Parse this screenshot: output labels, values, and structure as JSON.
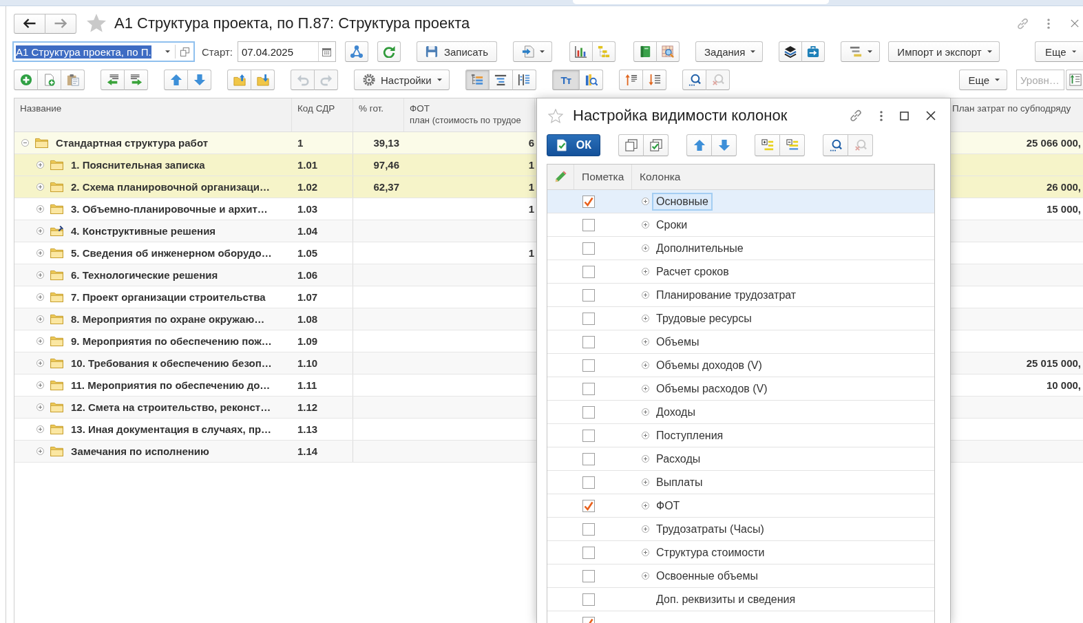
{
  "form": {
    "title": "А1 Структура проекта, по П.87: Структура проекта",
    "nav_buttons": [
      {
        "disabled": false
      },
      {
        "disabled": true
      }
    ]
  },
  "toolbar_rows": [
    [
      {
        "kind": "select",
        "value": "А1 Структура проекта, по П.",
        "focused": true
      },
      {
        "kind": "label",
        "text": "Старт:"
      },
      {
        "kind": "date",
        "value": "07.04.2025"
      },
      {
        "kind": "group",
        "buttons": [
          {
            "menu": false,
            "pressed": false,
            "disabled": false
          }
        ]
      },
      {
        "kind": "group",
        "buttons": [
          {
            "menu": false,
            "pressed": false,
            "disabled": false
          }
        ]
      },
      {
        "kind": "group",
        "buttons": [
          {
            "label": "Записать",
            "menu": false,
            "pressed": false,
            "disabled": false
          }
        ]
      },
      {
        "kind": "group",
        "buttons": [
          {
            "menu": true,
            "pressed": false,
            "disabled": false
          }
        ]
      },
      {
        "kind": "group",
        "buttons": [
          {
            "menu": false,
            "pressed": false,
            "disabled": false
          },
          {
            "menu": false,
            "pressed": false,
            "disabled": false
          }
        ]
      },
      {
        "kind": "group",
        "buttons": [
          {
            "menu": false,
            "pressed": false,
            "disabled": false
          },
          {
            "menu": false,
            "pressed": false,
            "disabled": false
          }
        ]
      },
      {
        "kind": "group",
        "buttons": [
          {
            "label": "Задания",
            "menu": true,
            "pressed": false,
            "disabled": false
          }
        ]
      },
      {
        "kind": "group",
        "buttons": [
          {
            "menu": false,
            "pressed": false,
            "disabled": false
          },
          {
            "menu": false,
            "pressed": false,
            "disabled": false
          }
        ]
      },
      {
        "kind": "group",
        "buttons": [
          {
            "menu": true,
            "pressed": false,
            "disabled": false
          }
        ]
      },
      {
        "kind": "group",
        "buttons": [
          {
            "label": "Импорт и экспорт",
            "menu": true,
            "pressed": false,
            "disabled": false
          }
        ]
      },
      {
        "kind": "group",
        "buttons": [
          {
            "label": "Еще",
            "menu": true,
            "pressed": false,
            "disabled": false
          }
        ]
      }
    ],
    [
      {
        "kind": "group",
        "buttons": [
          {
            "menu": false,
            "pressed": false,
            "disabled": false
          },
          {
            "menu": false,
            "pressed": false,
            "disabled": false
          },
          {
            "menu": false,
            "pressed": false,
            "disabled": false
          }
        ]
      },
      {
        "kind": "group",
        "buttons": [
          {
            "menu": false,
            "pressed": false,
            "disabled": false
          },
          {
            "menu": false,
            "pressed": false,
            "disabled": false
          }
        ]
      },
      {
        "kind": "group",
        "buttons": [
          {
            "menu": false,
            "pressed": false,
            "disabled": false
          },
          {
            "menu": false,
            "pressed": false,
            "disabled": false
          }
        ]
      },
      {
        "kind": "group",
        "buttons": [
          {
            "menu": false,
            "pressed": false,
            "disabled": false
          },
          {
            "menu": false,
            "pressed": false,
            "disabled": false
          }
        ]
      },
      {
        "kind": "group",
        "buttons": [
          {
            "menu": false,
            "pressed": false,
            "disabled": true
          },
          {
            "menu": false,
            "pressed": false,
            "disabled": true
          }
        ]
      },
      {
        "kind": "group",
        "buttons": [
          {
            "label": "Настройки",
            "menu": true,
            "pressed": false,
            "disabled": false
          }
        ]
      },
      {
        "kind": "group",
        "buttons": [
          {
            "menu": false,
            "pressed": true,
            "disabled": false
          },
          {
            "menu": false,
            "pressed": false,
            "disabled": false
          },
          {
            "menu": false,
            "pressed": false,
            "disabled": false
          }
        ]
      },
      {
        "kind": "group",
        "buttons": [
          {
            "glyph": "Тт",
            "menu": false,
            "pressed": true,
            "disabled": false
          },
          {
            "menu": false,
            "pressed": false,
            "disabled": false
          }
        ]
      },
      {
        "kind": "group",
        "buttons": [
          {
            "menu": false,
            "pressed": false,
            "disabled": false
          },
          {
            "menu": false,
            "pressed": false,
            "disabled": false
          }
        ]
      },
      {
        "kind": "group",
        "buttons": [
          {
            "menu": false,
            "pressed": false,
            "disabled": false
          },
          {
            "menu": false,
            "pressed": false,
            "disabled": true
          }
        ]
      },
      {
        "kind": "group",
        "buttons": [
          {
            "label": "Еще",
            "menu": true,
            "pressed": false,
            "disabled": false
          }
        ]
      },
      {
        "kind": "field",
        "placeholder": "Уровн…"
      },
      {
        "kind": "group",
        "buttons": [
          {
            "menu": false,
            "pressed": false,
            "disabled": false
          }
        ]
      }
    ]
  ],
  "table": {
    "columns": [
      {
        "title": "Название"
      },
      {
        "title": "Код СДР"
      },
      {
        "title": "% гот."
      },
      {
        "title": "ФОТ",
        "subtitle": "план (стоимость по трудое"
      },
      {
        "title": "План затрат по субподряду"
      }
    ],
    "rows": [
      {
        "name": "Стандартная структура работ",
        "code": "1",
        "ready": "39,13",
        "fot": "6",
        "subcontract": "25 066 000,",
        "kind": "folder",
        "expanded": true,
        "color": "#fbfbe8",
        "children": [
          {
            "name": "1. Пояснительная записка",
            "code": "1.01",
            "ready": "97,46",
            "fot": "1",
            "kind": "folder",
            "expanded": false,
            "color": "#f6f4c9"
          },
          {
            "name": "2. Схема планировочной организаци…",
            "code": "1.02",
            "ready": "62,37",
            "fot": "1",
            "subcontract": "26 000,",
            "kind": "folder",
            "expanded": false,
            "color": "#f6f4c9"
          },
          {
            "name": "3. Объемно-планировочные и архит…",
            "code": "1.03",
            "fot": "1",
            "subcontract": "15 000,",
            "kind": "folder",
            "expanded": false
          },
          {
            "name": "4. Конструктивные решения",
            "code": "1.04",
            "kind": "folder-pinned",
            "expanded": false
          },
          {
            "name": "5. Сведения об инженерном оборудо…",
            "code": "1.05",
            "fot": "1",
            "kind": "folder",
            "expanded": false
          },
          {
            "name": "6. Технологические решения",
            "code": "1.06",
            "kind": "folder",
            "expanded": false
          },
          {
            "name": "7. Проект организации строительства",
            "code": "1.07",
            "kind": "folder",
            "expanded": false
          },
          {
            "name": "8. Мероприятия по охране окружаю…",
            "code": "1.08",
            "kind": "folder",
            "expanded": false
          },
          {
            "name": "9. Мероприятия по обеспечению пож…",
            "code": "1.09",
            "kind": "folder",
            "expanded": false
          },
          {
            "name": "10. Требования к обеспечению безоп…",
            "code": "1.10",
            "subcontract": "25 015 000,",
            "kind": "folder",
            "expanded": false
          },
          {
            "name": "11. Мероприятия по обеспечению до…",
            "code": "1.11",
            "subcontract": "10 000,",
            "kind": "folder",
            "expanded": false
          },
          {
            "name": "12. Смета на строительство, реконст…",
            "code": "1.12",
            "kind": "folder",
            "expanded": false
          },
          {
            "name": "13. Иная документация в случаях, пр…",
            "code": "1.13",
            "kind": "folder",
            "expanded": false
          },
          {
            "name": "Замечания по исполнению",
            "code": "1.14",
            "kind": "folder",
            "expanded": false
          }
        ]
      }
    ]
  },
  "dialog": {
    "title": "Настройка видимости колонок",
    "toolbar": [
      {
        "kind": "primary",
        "buttons": [
          {
            "label": "ОК",
            "menu": false,
            "pressed": false,
            "disabled": false
          }
        ]
      },
      {
        "kind": "group",
        "buttons": [
          {
            "menu": false,
            "pressed": false,
            "disabled": false
          },
          {
            "menu": false,
            "pressed": false,
            "disabled": false
          }
        ]
      },
      {
        "kind": "group",
        "buttons": [
          {
            "menu": false,
            "pressed": false,
            "disabled": false
          },
          {
            "menu": false,
            "pressed": false,
            "disabled": false
          }
        ]
      },
      {
        "kind": "group",
        "buttons": [
          {
            "menu": false,
            "pressed": false,
            "disabled": false
          },
          {
            "menu": false,
            "pressed": false,
            "disabled": false
          }
        ]
      },
      {
        "kind": "group",
        "buttons": [
          {
            "menu": false,
            "pressed": false,
            "disabled": false
          },
          {
            "menu": false,
            "pressed": false,
            "disabled": true
          }
        ]
      }
    ],
    "table": {
      "columns": [
        "Пометка",
        "Колонка"
      ],
      "rows": [
        {
          "label": "Основные",
          "kind": "group",
          "expanded": false,
          "checked": true,
          "selected": true
        },
        {
          "label": "Сроки",
          "kind": "group",
          "expanded": false,
          "checked": false,
          "selected": false
        },
        {
          "label": "Дополнительные",
          "kind": "group",
          "expanded": false,
          "checked": false,
          "selected": false
        },
        {
          "label": "Расчет сроков",
          "kind": "group",
          "expanded": false,
          "checked": false,
          "selected": false
        },
        {
          "label": "Планирование трудозатрат",
          "kind": "group",
          "expanded": false,
          "checked": false,
          "selected": false
        },
        {
          "label": "Трудовые ресурсы",
          "kind": "group",
          "expanded": false,
          "checked": false,
          "selected": false
        },
        {
          "label": "Объемы",
          "kind": "group",
          "expanded": false,
          "checked": false,
          "selected": false
        },
        {
          "label": "Объемы доходов (V)",
          "kind": "group",
          "expanded": false,
          "checked": false,
          "selected": false
        },
        {
          "label": "Объемы расходов (V)",
          "kind": "group",
          "expanded": false,
          "checked": false,
          "selected": false
        },
        {
          "label": "Доходы",
          "kind": "group",
          "expanded": false,
          "checked": false,
          "selected": false
        },
        {
          "label": "Поступления",
          "kind": "group",
          "expanded": false,
          "checked": false,
          "selected": false
        },
        {
          "label": "Расходы",
          "kind": "group",
          "expanded": false,
          "checked": false,
          "selected": false
        },
        {
          "label": "Выплаты",
          "kind": "group",
          "expanded": false,
          "checked": false,
          "selected": false
        },
        {
          "label": "ФОТ",
          "kind": "group",
          "expanded": false,
          "checked": true,
          "selected": false
        },
        {
          "label": "Трудозатраты (Часы)",
          "kind": "group",
          "expanded": false,
          "checked": false,
          "selected": false
        },
        {
          "label": "Структура стоимости",
          "kind": "group",
          "expanded": false,
          "checked": false,
          "selected": false
        },
        {
          "label": "Освоенные объемы",
          "kind": "group",
          "expanded": false,
          "checked": false,
          "selected": false
        },
        {
          "label": "Доп. реквизиты и сведения",
          "kind": "field",
          "checked": false,
          "selected": false
        },
        {
          "kind": "field",
          "checked": true,
          "selected": false
        }
      ]
    }
  }
}
